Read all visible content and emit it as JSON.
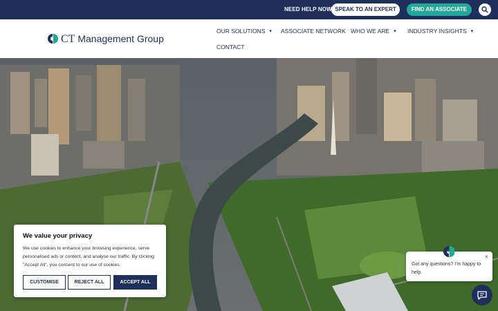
{
  "topbar": {
    "need_help": "NEED HELP NOW?",
    "speak_button": "SPEAK TO AN EXPERT",
    "find_button": "FIND AN ASSOCIATE",
    "search_icon": "search-icon",
    "colors": {
      "bar": "#1f2f5c",
      "accent": "#23a79a"
    }
  },
  "header": {
    "logo_ct": "CT",
    "logo_name": "Management Group",
    "nav": [
      {
        "label": "OUR SOLUTIONS",
        "dropdown": true
      },
      {
        "label": "ASSOCIATE NETWORK",
        "dropdown": false
      },
      {
        "label": "WHO WE ARE",
        "dropdown": true
      },
      {
        "label": "INDUSTRY INSIGHTS",
        "dropdown": true
      },
      {
        "label": "CONTACT",
        "dropdown": false
      }
    ],
    "caret": "▾"
  },
  "hero": {
    "image": "aerial city and river photo"
  },
  "cookie": {
    "title": "We value your privacy",
    "text": "We use cookies to enhance your browsing experience, serve personalised ads or content, and analyse our traffic. By clicking \"Accept All\", you consent to our use of cookies.",
    "customise": "CUSTOMISE",
    "reject": "REJECT ALL",
    "accept": "ACCEPT ALL"
  },
  "chat": {
    "message": "Got any questions? I'm happy to help.",
    "close": "×",
    "launcher_icon": "chat-icon"
  }
}
